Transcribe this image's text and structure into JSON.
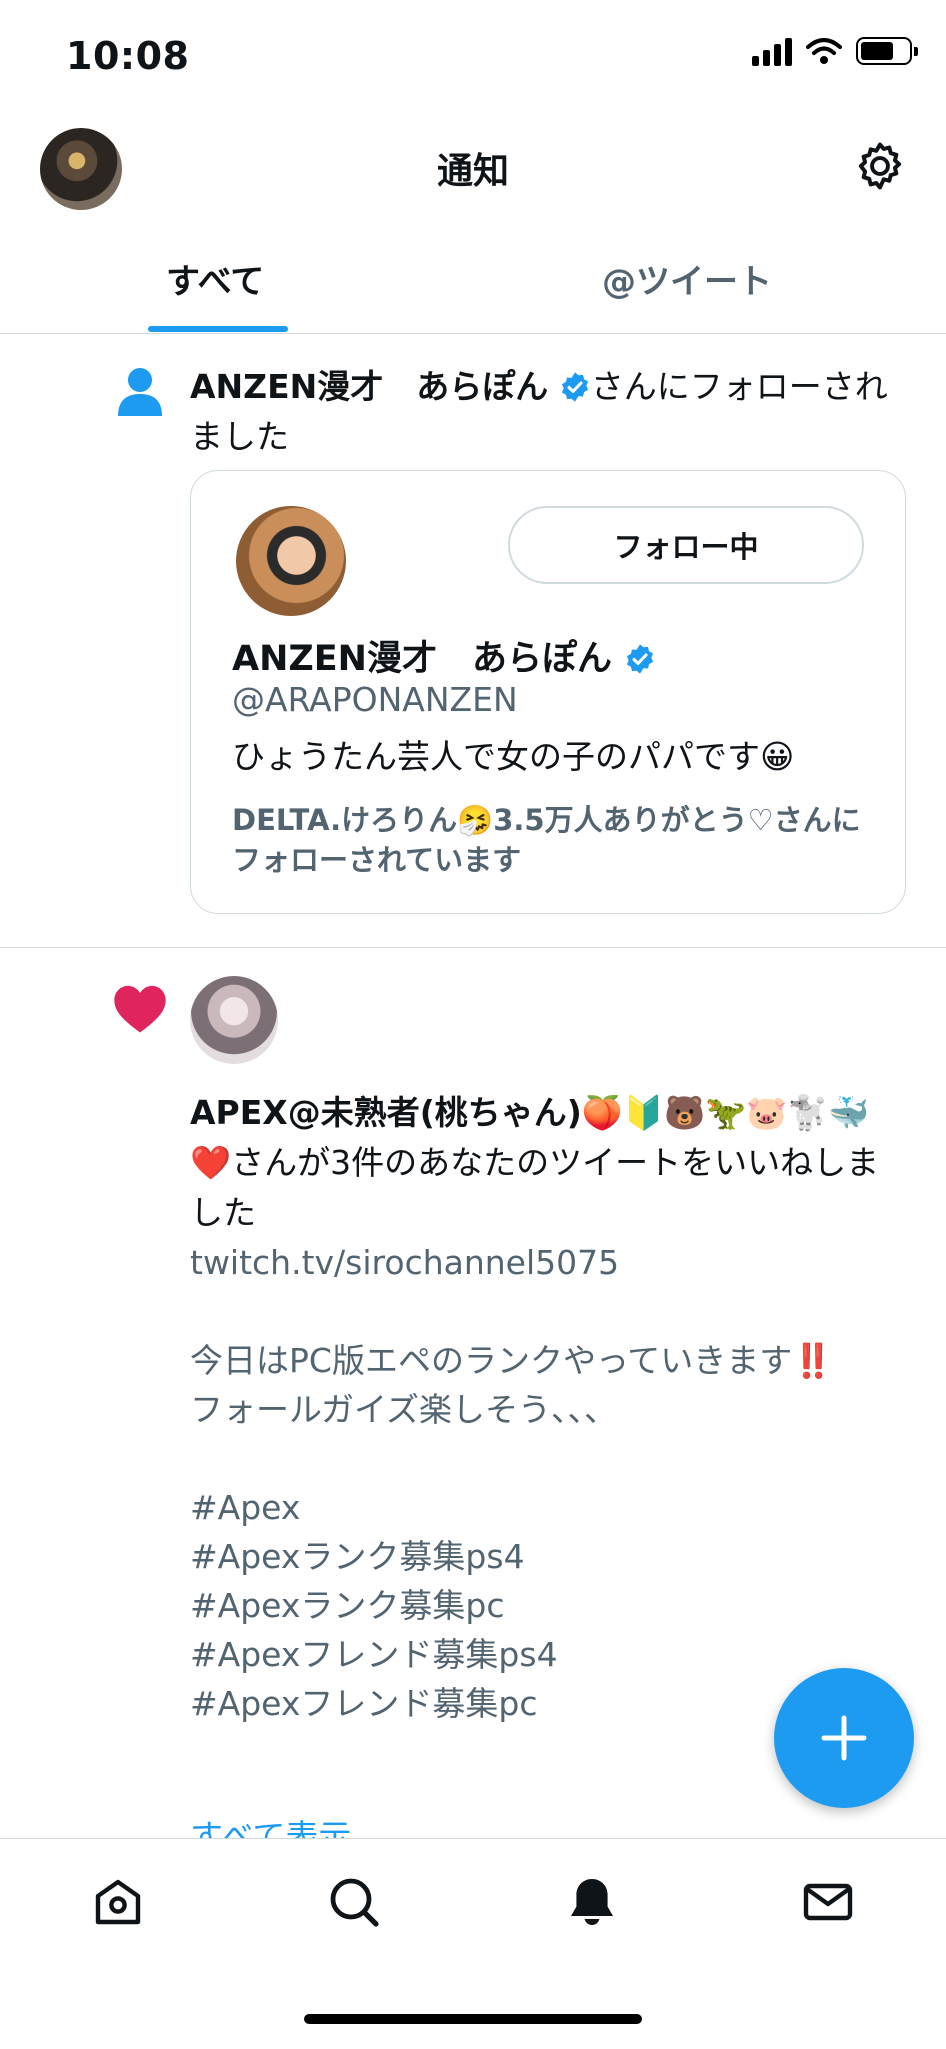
{
  "status_bar": {
    "time": "10:08"
  },
  "header": {
    "title": "通知"
  },
  "tabs": [
    {
      "label": "すべて",
      "active": true
    },
    {
      "label": "@ツイート",
      "active": false
    }
  ],
  "follow_notification": {
    "user_name": "ANZEN漫才　あらぽん",
    "text_suffix": "さんにフォローされました",
    "card": {
      "name": "ANZEN漫才　あらぽん",
      "handle": "@ARAPONANZEN",
      "bio": "ひょうたん芸人で女の子のパパです😀",
      "follow_button": "フォロー中",
      "context": "DELTA.けろりん🤧3.5万人ありがとう♡さんにフォローされています"
    }
  },
  "like_notification": {
    "user_name": "APEX@未熟者(桃ちゃん)🍑🔰🐻🦖🐷🐩🐳❤️",
    "text_suffix": "さんが3件のあなたのツイートをいいねしました",
    "tweet_text": "twitch.tv/sirochannel5075\n\n今日はPC版エペのランクやっていきます‼️\nフォールガイズ楽しそう、、、\n\n#Apex\n#Apexランク募集ps4\n#Apexランク募集pc\n#Apexフレンド募集ps4\n#Apexフレンド募集pc",
    "show_more": "すべて表示"
  },
  "colors": {
    "accent": "#1d9bf0",
    "like": "#e0245e",
    "secondary_text": "#536471",
    "divider": "#cfd9de"
  },
  "icons": [
    "signal-icon",
    "wifi-icon",
    "battery-icon",
    "gear-icon",
    "person-icon",
    "verified-icon",
    "heart-icon",
    "plus-icon",
    "home-icon",
    "search-icon",
    "bell-icon",
    "mail-icon"
  ]
}
